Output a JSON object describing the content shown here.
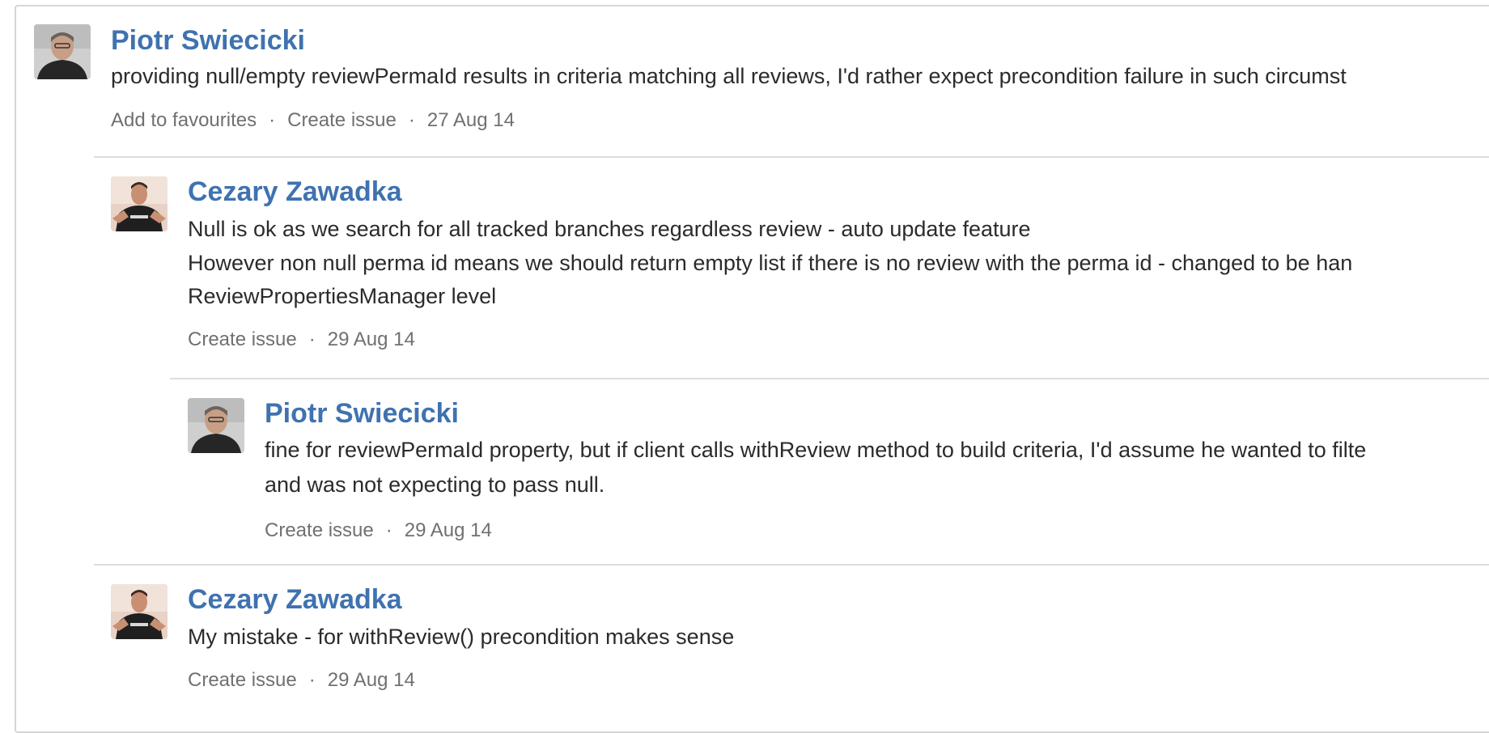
{
  "comments": [
    {
      "author": "Piotr Swiecicki",
      "lines": [
        "providing null/empty reviewPermaId results in criteria matching all reviews, I'd rather expect precondition failure in such circumst"
      ],
      "actions": {
        "favourite": "Add to favourites",
        "create_issue": "Create issue",
        "separator": "·",
        "date": "27 Aug 14"
      }
    },
    {
      "author": "Cezary Zawadka",
      "lines": [
        "Null is ok as we search for all tracked branches regardless review - auto update feature",
        "However non null perma id means we should return empty list if there is no review with the perma id - changed to be han",
        "ReviewPropertiesManager level"
      ],
      "actions": {
        "create_issue": "Create issue",
        "separator": "·",
        "date": "29 Aug 14"
      }
    },
    {
      "author": "Piotr Swiecicki",
      "lines": [
        "fine for reviewPermaId property, but if client calls withReview method to build criteria, I'd assume he wanted to filte",
        "and was not expecting to pass null."
      ],
      "actions": {
        "create_issue": "Create issue",
        "separator": "·",
        "date": "29 Aug 14"
      }
    },
    {
      "author": "Cezary Zawadka",
      "lines": [
        "My mistake - for withReview() precondition makes sense"
      ],
      "actions": {
        "create_issue": "Create issue",
        "separator": "·",
        "date": "29 Aug 14"
      }
    }
  ]
}
